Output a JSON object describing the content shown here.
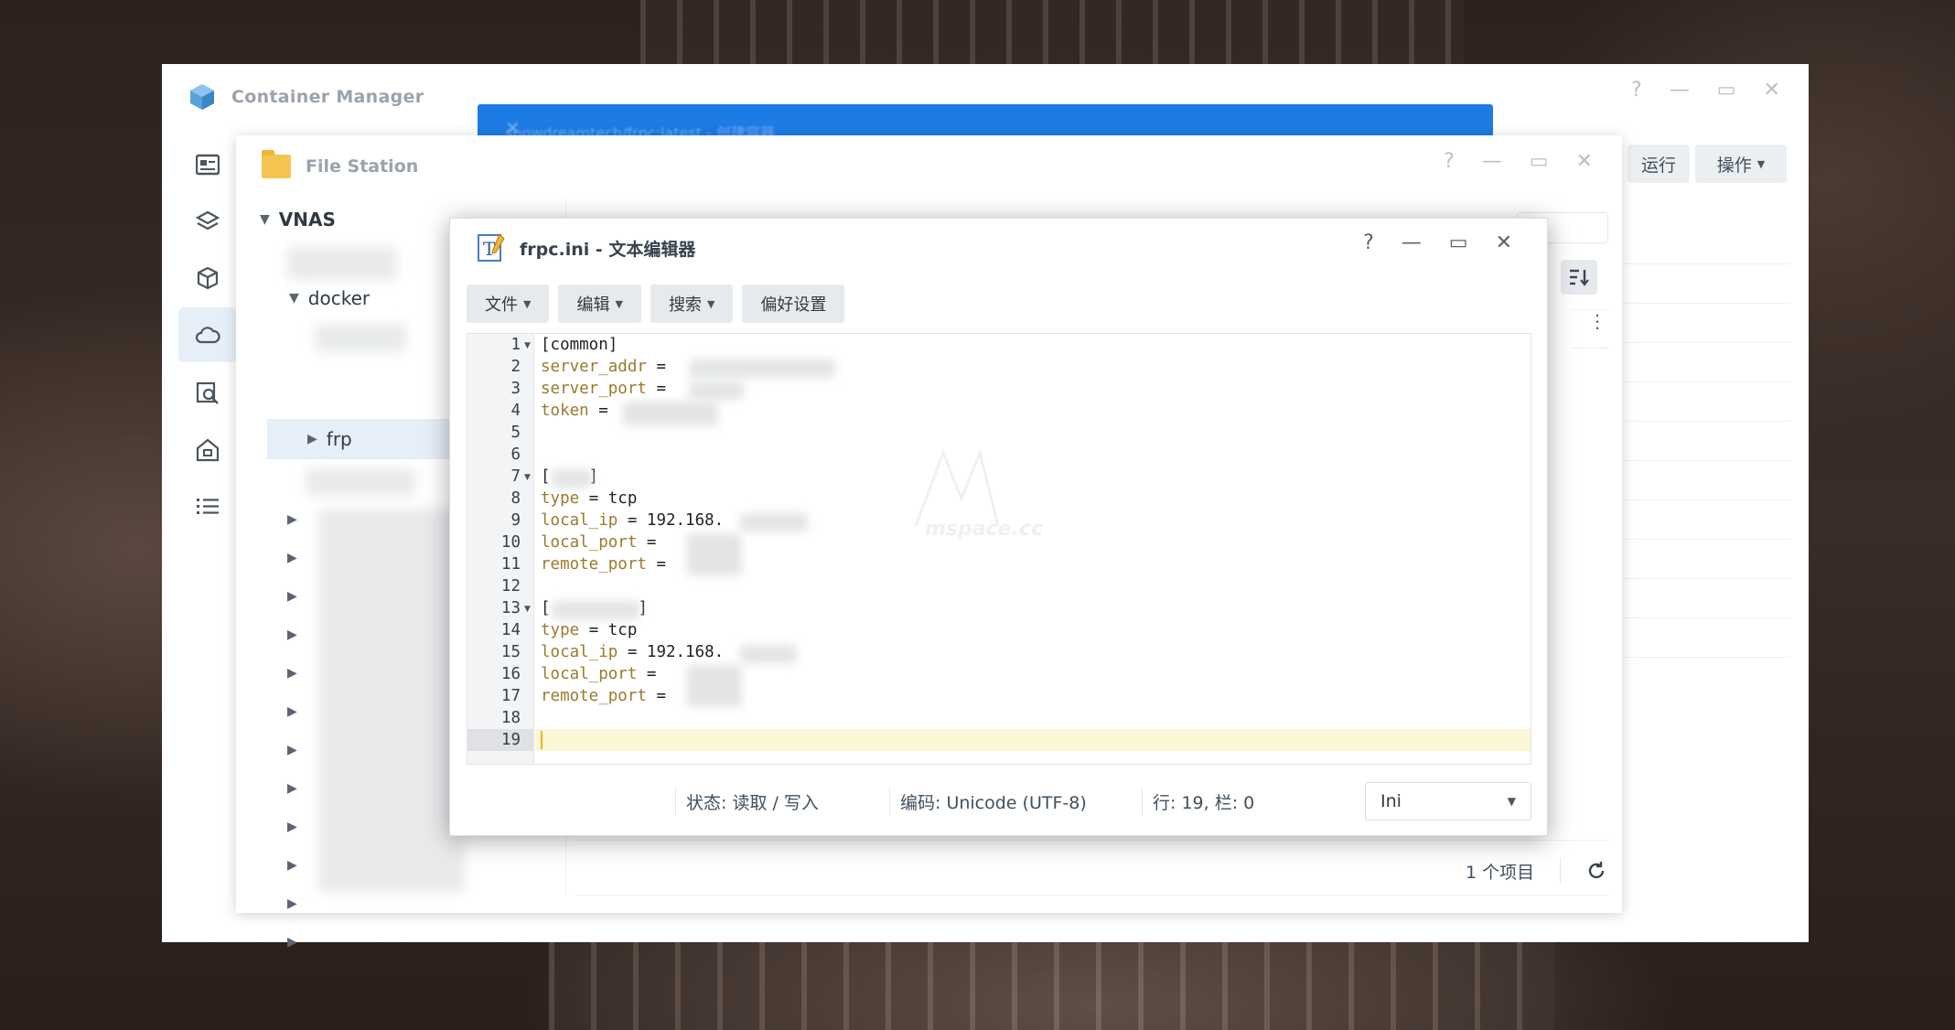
{
  "container_manager": {
    "title": "Container Manager",
    "buttons": {
      "run": "运行",
      "action": "操作"
    },
    "modal_title": "snowdreamtech/frpc:latest - 创建容器"
  },
  "file_station": {
    "title": "File Station",
    "tree": {
      "root": "VNAS",
      "docker": "docker",
      "frp": "frp"
    },
    "status": {
      "count": "1 个项目"
    }
  },
  "editor": {
    "title": "frpc.ini - 文本编辑器",
    "menus": {
      "file": "文件",
      "edit": "编辑",
      "search": "搜索",
      "prefs": "偏好设置"
    },
    "lines": {
      "l1": "[common]",
      "l2_key": "server_addr",
      "l2_op": " = ",
      "l3_key": "server_port",
      "l3_op": " = ",
      "l4_key": "token",
      "l4_op": " = ",
      "l7_open": "[",
      "l7_close": "]",
      "l8_key": "type",
      "l8_val": " = tcp",
      "l9_key": "local_ip",
      "l9_val": " = 192.168.",
      "l10_key": "local_port",
      "l10_op": " = ",
      "l11_key": "remote_port",
      "l11_op": " = ",
      "l13_open": "[",
      "l13_close": "]",
      "l14_key": "type",
      "l14_val": " = tcp",
      "l15_key": "local_ip",
      "l15_val": " = 192.168.",
      "l16_key": "local_port",
      "l16_op": " = ",
      "l17_key": "remote_port",
      "l17_op": " = "
    },
    "line_numbers": [
      "1",
      "2",
      "3",
      "4",
      "5",
      "6",
      "7",
      "8",
      "9",
      "10",
      "11",
      "12",
      "13",
      "14",
      "15",
      "16",
      "17",
      "18",
      "19"
    ],
    "status": {
      "state": "状态: 读取 / 写入",
      "encoding": "编码: Unicode (UTF-8)",
      "position": "行: 19, 栏: 0",
      "language": "Ini"
    }
  },
  "colors": {
    "accent": "#1d7be4",
    "key": "#9b7a2e",
    "current_line": "#fbf7d6"
  }
}
